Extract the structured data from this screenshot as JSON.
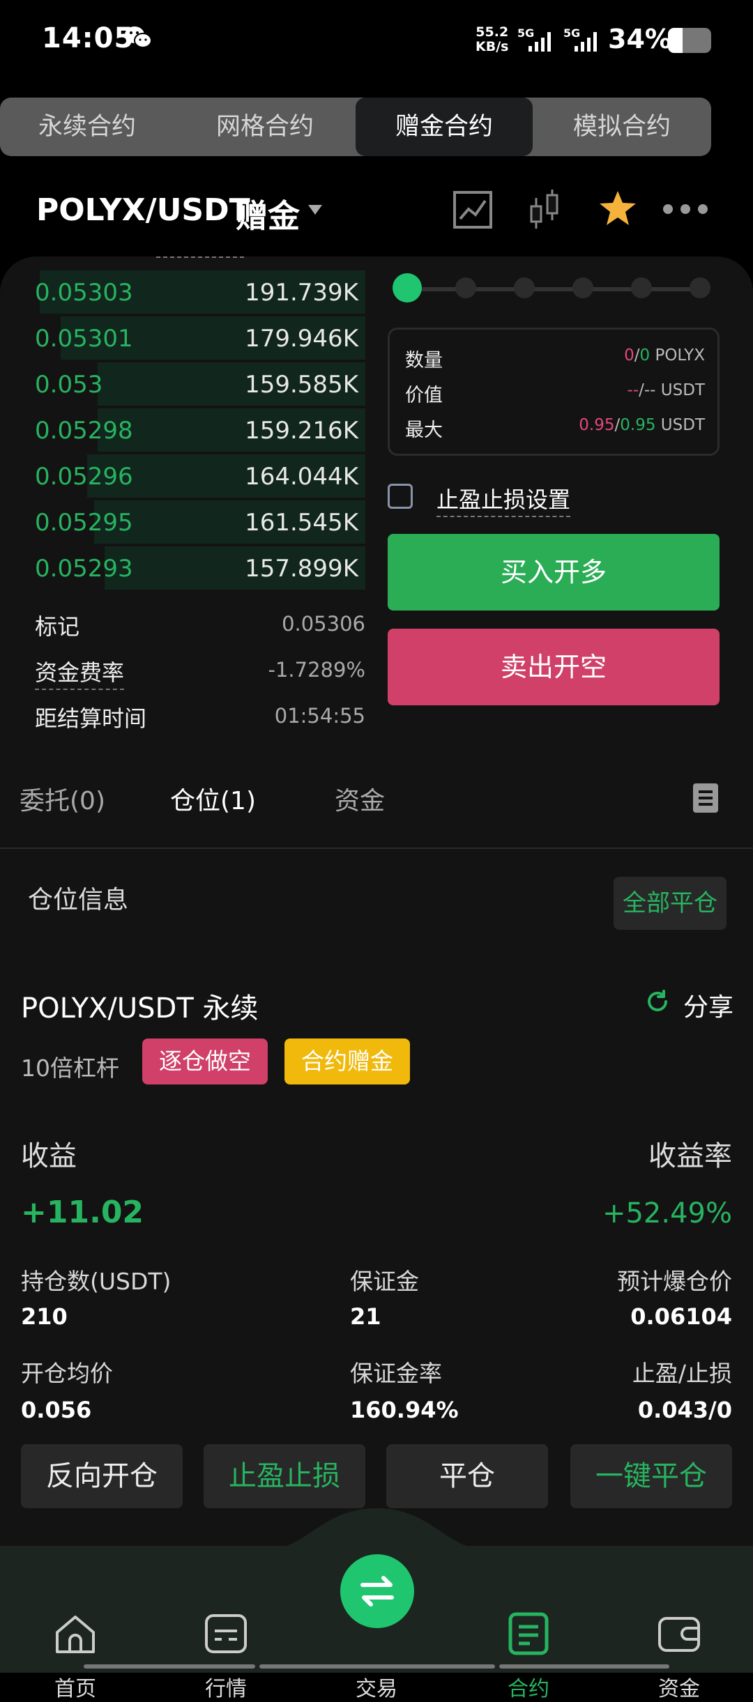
{
  "status_bar": {
    "time": "14:05",
    "net_speed_value": "55.2",
    "net_speed_unit": "KB/s",
    "sim1": "5G",
    "sim2": "5G",
    "battery": "34%",
    "battery_level": 0.34
  },
  "top_tabs": [
    {
      "label": "永续合约",
      "active": false
    },
    {
      "label": "网格合约",
      "active": false
    },
    {
      "label": "赠金合约",
      "active": true
    },
    {
      "label": "模拟合约",
      "active": false
    }
  ],
  "pair": {
    "symbol": "POLYX/USDT",
    "tag": "赠金"
  },
  "order_book": [
    {
      "price": "0.05303",
      "qty": "191.739K",
      "depth": 0.96
    },
    {
      "price": "0.05301",
      "qty": "179.946K",
      "depth": 0.9
    },
    {
      "price": "0.053",
      "qty": "159.585K",
      "depth": 0.79
    },
    {
      "price": "0.05298",
      "qty": "159.216K",
      "depth": 0.79
    },
    {
      "price": "0.05296",
      "qty": "164.044K",
      "depth": 0.82
    },
    {
      "price": "0.05295",
      "qty": "161.545K",
      "depth": 0.8
    },
    {
      "price": "0.05293",
      "qty": "157.899K",
      "depth": 0.77
    }
  ],
  "market_info": {
    "mark_label": "标记",
    "mark_value": "0.05306",
    "funding_label": "资金费率",
    "funding_value": "-1.7289%",
    "settle_label": "距结算时间",
    "settle_value": "01:54:55"
  },
  "leverage_slider": {
    "stops": 6,
    "selected": 0
  },
  "order_form": {
    "qty_label": "数量",
    "qty_a": "0",
    "qty_sep": "/",
    "qty_b": "0",
    "qty_unit": "POLYX",
    "value_label": "价值",
    "value_a": "--",
    "value_sep": "/",
    "value_b": "--",
    "value_unit": "USDT",
    "max_label": "最大",
    "max_a": "0.95",
    "max_sep": "/",
    "max_b": "0.95",
    "max_unit": "USDT",
    "tpsl_label": "止盈止损设置",
    "buy_label": "买入开多",
    "sell_label": "卖出开空"
  },
  "sub_tabs": {
    "orders": "委托(0)",
    "positions": "仓位(1)",
    "assets": "资金"
  },
  "position": {
    "section_title": "仓位信息",
    "close_all": "全部平仓",
    "symbol": "POLYX/USDT 永续",
    "share": "分享",
    "leverage": "10倍杠杆",
    "mode_badge": "逐仓做空",
    "bonus_badge": "合约赠金",
    "pnl_label": "收益",
    "pnl_value": "+11.02",
    "roe_label": "收益率",
    "roe_value": "+52.49%",
    "size_label": "持仓数(USDT)",
    "size_value": "210",
    "margin_label": "保证金",
    "margin_value": "21",
    "liq_label": "预计爆仓价",
    "liq_value": "0.06104",
    "entry_label": "开仓均价",
    "entry_value": "0.056",
    "margin_rate_label": "保证金率",
    "margin_rate_value": "160.94%",
    "tpsl_label": "止盈/止损",
    "tpsl_value": "0.043/0",
    "actions": [
      "反向开仓",
      "止盈止损",
      "平仓",
      "一键平仓"
    ]
  },
  "bottom_nav": [
    {
      "label": "首页",
      "icon": "home-icon"
    },
    {
      "label": "行情",
      "icon": "market-icon"
    },
    {
      "label": "交易",
      "icon": "swap-icon"
    },
    {
      "label": "合约",
      "icon": "contract-icon"
    },
    {
      "label": "资金",
      "icon": "wallet-icon"
    }
  ],
  "colors": {
    "green": "#27b460",
    "pink": "#e4477a",
    "buy": "#2aad55",
    "sell": "#d04068",
    "badge_yellow": "#f0b90b"
  }
}
